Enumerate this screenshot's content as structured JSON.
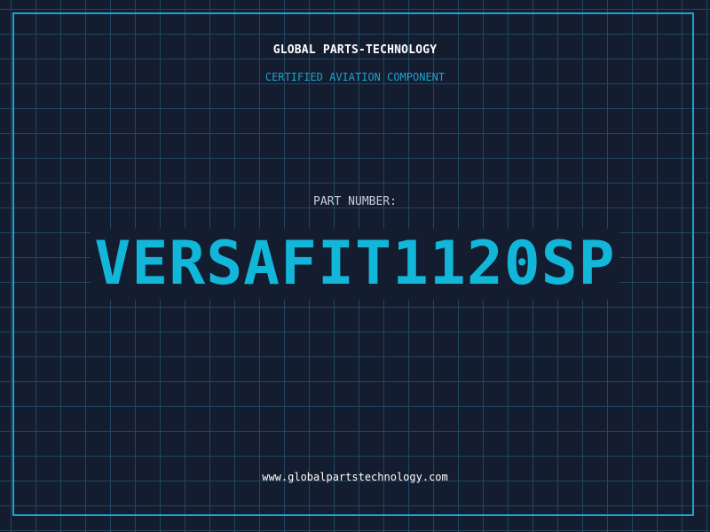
{
  "header": {
    "company": "GLOBAL PARTS-TECHNOLOGY",
    "tagline": "CERTIFIED AVIATION COMPONENT"
  },
  "main": {
    "part_label": "PART NUMBER:",
    "part_number": "VERSAFIT1120SP"
  },
  "footer": {
    "website": "www.globalpartstechnology.com"
  },
  "colors": {
    "background": "#141c30",
    "grid": "#1f4760",
    "accent": "#12b6d9",
    "frame": "#1aa3cc"
  }
}
